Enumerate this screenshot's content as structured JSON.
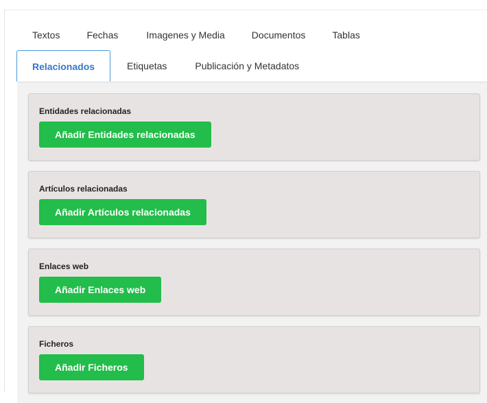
{
  "tabs_row1": [
    "Textos",
    "Fechas",
    "Imagenes y Media",
    "Documentos",
    "Tablas"
  ],
  "tabs_row2": [
    "Relacionados",
    "Etiquetas",
    "Publicación y Metadatos"
  ],
  "active_tab": "Relacionados",
  "sections": [
    {
      "title": "Entidades relacionadas",
      "button": "Añadir Entidades relacionadas"
    },
    {
      "title": "Artículos relacionadas",
      "button": "Añadir Artículos relacionadas"
    },
    {
      "title": "Enlaces web",
      "button": "Añadir Enlaces web"
    },
    {
      "title": "Ficheros",
      "button": "Añadir Ficheros"
    }
  ],
  "colors": {
    "active_tab_text": "#3479c9",
    "active_tab_border": "#4a9ad9",
    "button_bg": "#22bd4a",
    "section_bg": "#e8e3e3",
    "panel_bg": "#f2f2f2"
  }
}
